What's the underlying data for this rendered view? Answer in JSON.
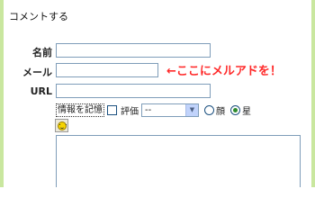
{
  "form": {
    "heading": "コメントする",
    "name_label": "名前",
    "mail_label": "メール",
    "url_label": "URL",
    "name_value": "",
    "mail_value": "",
    "url_value": "",
    "comment_value": ""
  },
  "annotation": "←ここにメルアドを！",
  "options": {
    "remember_label": "情報を記憶",
    "remember_checked": false,
    "rating_label": "評価",
    "rating_selected": "--",
    "icon_choices": [
      "顔",
      "星"
    ],
    "icon_selected": "星"
  },
  "colors": {
    "accent_strip": "#c9e79f",
    "annotation": "#ff2a2a",
    "input_border": "#7f9db9"
  },
  "icons": {
    "smiley": "smiley-icon",
    "dropdown": "chevron-down-icon"
  }
}
